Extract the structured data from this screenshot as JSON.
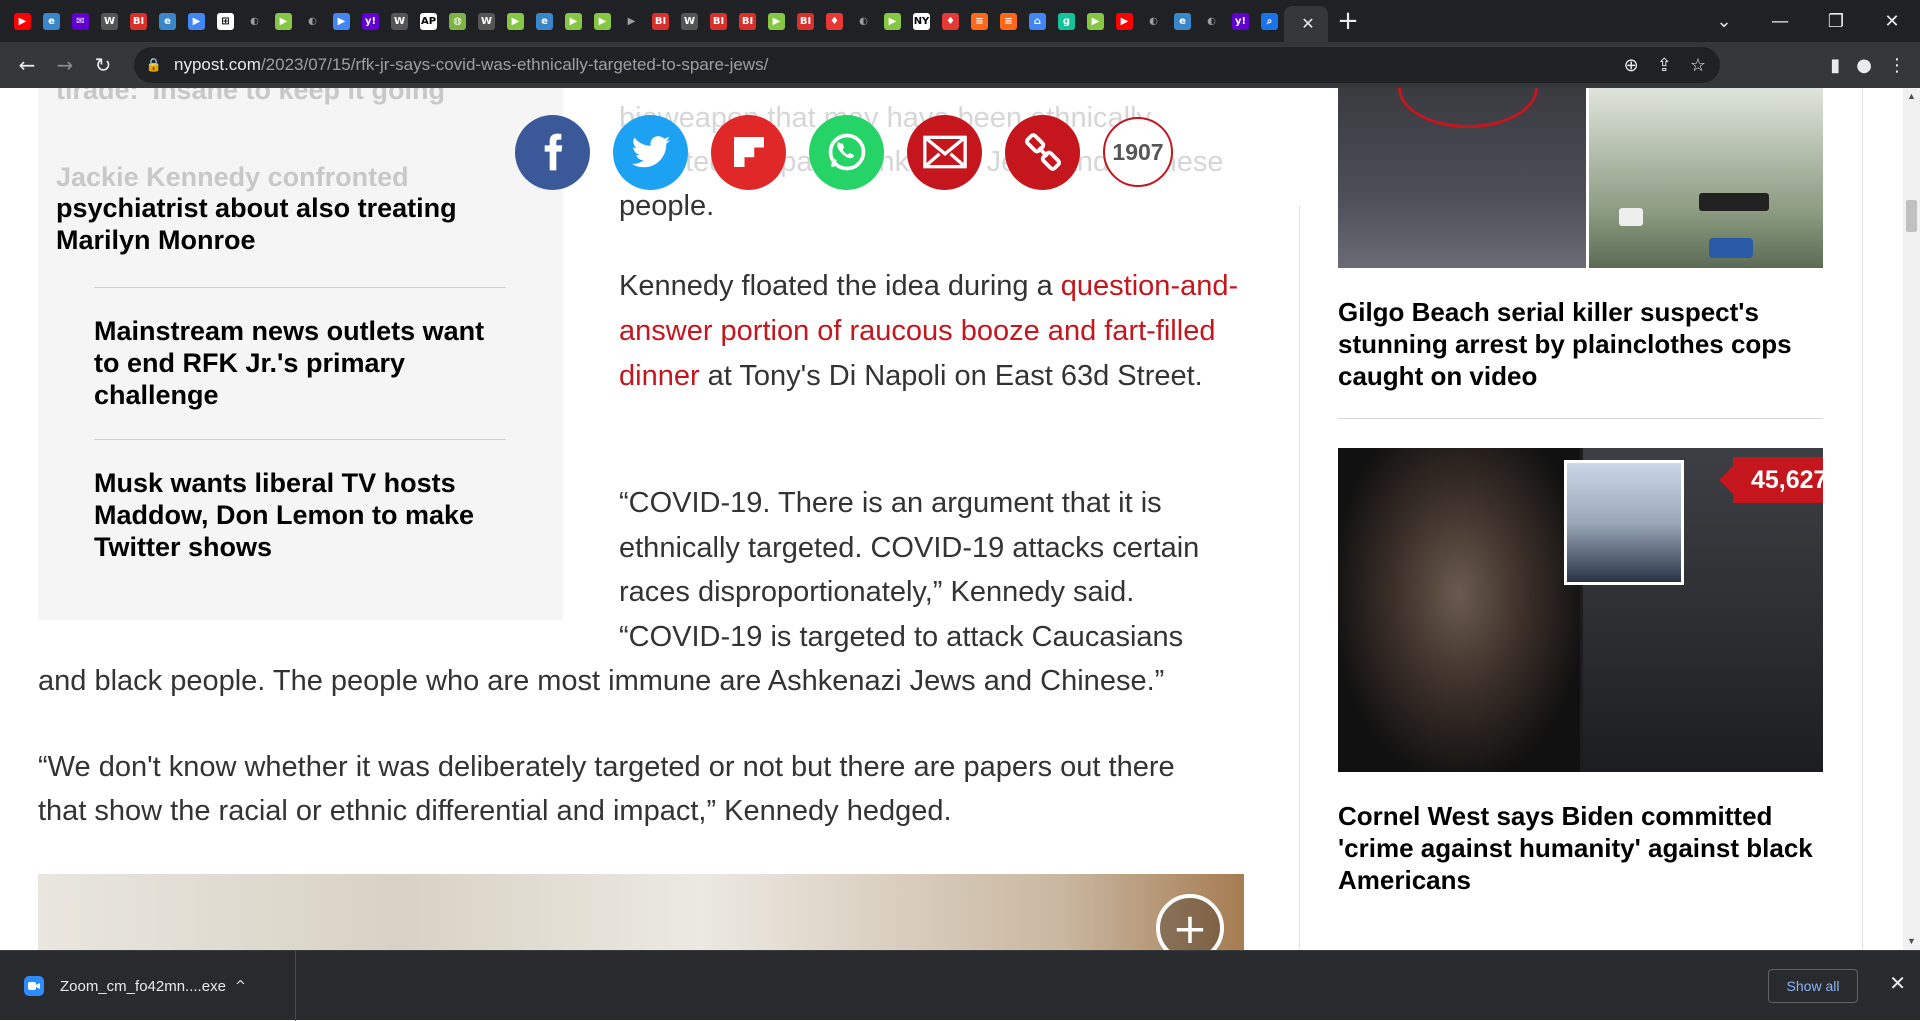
{
  "browser": {
    "tabs": [
      {
        "icon": "youtube-icon",
        "color": "#ff0000",
        "glyph": "▶"
      },
      {
        "icon": "edge-icon",
        "color": "#3a86c8",
        "glyph": "e"
      },
      {
        "icon": "yahoo-mail-icon",
        "color": "#6001d2",
        "glyph": "✉"
      },
      {
        "icon": "wsj-icon",
        "color": "#555555",
        "glyph": "W"
      },
      {
        "icon": "business-insider-icon",
        "color": "#d8302b",
        "glyph": "BI"
      },
      {
        "icon": "edge-icon",
        "color": "#3a86c8",
        "glyph": "e"
      },
      {
        "icon": "power-bi-icon",
        "color": "#4285f4",
        "glyph": "▶"
      },
      {
        "icon": "sheets-icon",
        "color": "#ffffff",
        "glyph": "⊞"
      },
      {
        "icon": "globe-icon",
        "color": "#9aa0a6",
        "glyph": "◐"
      },
      {
        "icon": "rumble-icon",
        "color": "#85c742",
        "glyph": "▶"
      },
      {
        "icon": "globe-icon",
        "color": "#9aa0a6",
        "glyph": "◐"
      },
      {
        "icon": "power-bi-icon",
        "color": "#4285f4",
        "glyph": "▶"
      },
      {
        "icon": "yahoo-icon",
        "color": "#6001d2",
        "glyph": "y!"
      },
      {
        "icon": "wsj-icon",
        "color": "#555555",
        "glyph": "W"
      },
      {
        "icon": "ap-icon",
        "color": "#ffffff",
        "glyph": "AP"
      },
      {
        "icon": "globe-icon",
        "color": "#7cb342",
        "glyph": "◍"
      },
      {
        "icon": "wsj-icon",
        "color": "#555555",
        "glyph": "W"
      },
      {
        "icon": "rumble-icon",
        "color": "#85c742",
        "glyph": "▶"
      },
      {
        "icon": "edge-icon",
        "color": "#3a86c8",
        "glyph": "e"
      },
      {
        "icon": "rumble-icon",
        "color": "#85c742",
        "glyph": "▶"
      },
      {
        "icon": "rumble-icon",
        "color": "#85c742",
        "glyph": "▶"
      },
      {
        "icon": "power-bi-icon",
        "color": "#9aa0a6",
        "glyph": "▶"
      },
      {
        "icon": "business-insider-icon",
        "color": "#d8302b",
        "glyph": "BI"
      },
      {
        "icon": "wsj-icon",
        "color": "#555555",
        "glyph": "W"
      },
      {
        "icon": "business-insider-icon",
        "color": "#d8302b",
        "glyph": "BI"
      },
      {
        "icon": "business-insider-icon",
        "color": "#d8302b",
        "glyph": "BI"
      },
      {
        "icon": "rumble-icon",
        "color": "#85c742",
        "glyph": "▶"
      },
      {
        "icon": "business-insider-icon",
        "color": "#d8302b",
        "glyph": "BI"
      },
      {
        "icon": "podcast-icon",
        "color": "#e53935",
        "glyph": "♦"
      },
      {
        "icon": "globe-icon",
        "color": "#9aa0a6",
        "glyph": "◐"
      },
      {
        "icon": "rumble-icon",
        "color": "#85c742",
        "glyph": "▶"
      },
      {
        "icon": "news-icon",
        "color": "#ffffff",
        "glyph": "NY"
      },
      {
        "icon": "podcast-icon",
        "color": "#e53935",
        "glyph": "♦"
      },
      {
        "icon": "substack-icon",
        "color": "#ff6719",
        "glyph": "≡"
      },
      {
        "icon": "substack-icon",
        "color": "#ff6719",
        "glyph": "≡"
      },
      {
        "icon": "lock-site-icon",
        "color": "#4285f4",
        "glyph": "⌂"
      },
      {
        "icon": "grammarly-icon",
        "color": "#15c39a",
        "glyph": "g"
      },
      {
        "icon": "rumble-icon",
        "color": "#85c742",
        "glyph": "▶"
      },
      {
        "icon": "youtube-icon",
        "color": "#ff0000",
        "glyph": "▶"
      },
      {
        "icon": "globe-icon",
        "color": "#9aa0a6",
        "glyph": "◐"
      },
      {
        "icon": "edge-icon",
        "color": "#3a86c8",
        "glyph": "e"
      },
      {
        "icon": "globe-icon",
        "color": "#9aa0a6",
        "glyph": "◐"
      },
      {
        "icon": "yahoo-icon",
        "color": "#6001d2",
        "glyph": "y!"
      },
      {
        "icon": "search-icon",
        "color": "#1a73e8",
        "glyph": "⌕"
      }
    ],
    "url_host": "nypost.com",
    "url_path": "/2023/07/15/rfk-jr-says-covid-was-ethnically-targeted-to-spare-jews/"
  },
  "related": {
    "items": [
      {
        "title": "tirade: 'Insane to keep it going'",
        "faded": true
      },
      {
        "title": "Jackie Kennedy confronted",
        "faded": true
      },
      {
        "title": "psychiatrist about also treating Marilyn Monroe",
        "faded": false
      },
      {
        "title": "Mainstream news outlets want to end RFK Jr.'s primary challenge",
        "faded": false
      },
      {
        "title": "Musk wants liberal TV hosts Maddow, Don Lemon to make Twitter shows",
        "faded": false
      }
    ]
  },
  "article": {
    "faded_top_line1": "bioweapon that may have been ethnically",
    "faded_top_line2": "targeted to spare Ashkenazi Jews and Chinese",
    "faded_top_line3": "people.",
    "p1_before": "Kennedy floated the idea during a ",
    "p1_link": "question-and-answer portion of raucous booze and fart-filled dinner",
    "p1_after": " at Tony's Di Napoli on East 63d Street.",
    "p2_line1": "“COVID-19. There is an argument that it is",
    "p2_line2": "ethnically targeted. COVID-19 attacks certain",
    "p2_line3": "races disproportionately,” Kennedy said.",
    "p2_line4": "“COVID-19 is targeted to attack Caucasians",
    "p2_line5": "and black people. The people who are most immune are Ashkenazi Jews and Chinese.”",
    "p3_line1": "“We don't know whether it was deliberately targeted or not but there are papers out there",
    "p3_line2": "that show the racial or ethnic differential and impact,” Kennedy hedged."
  },
  "share": {
    "comment_count": "1907",
    "colors": {
      "facebook": "#3b5998",
      "twitter": "#1da1f2",
      "flipboard": "#e12828",
      "whatsapp": "#25d366",
      "email": "#c4161c",
      "link": "#c4161c"
    }
  },
  "sidebar": {
    "headline1": "Gilgo Beach serial killer suspect's stunning arrest by plainclothes cops caught on video",
    "headline2": "Cornel West says Biden committed 'crime against humanity' against black Americans",
    "view_count": "45,627"
  },
  "downloads": {
    "file_name": "Zoom_cm_fo42mn....exe",
    "show_all": "Show all"
  }
}
